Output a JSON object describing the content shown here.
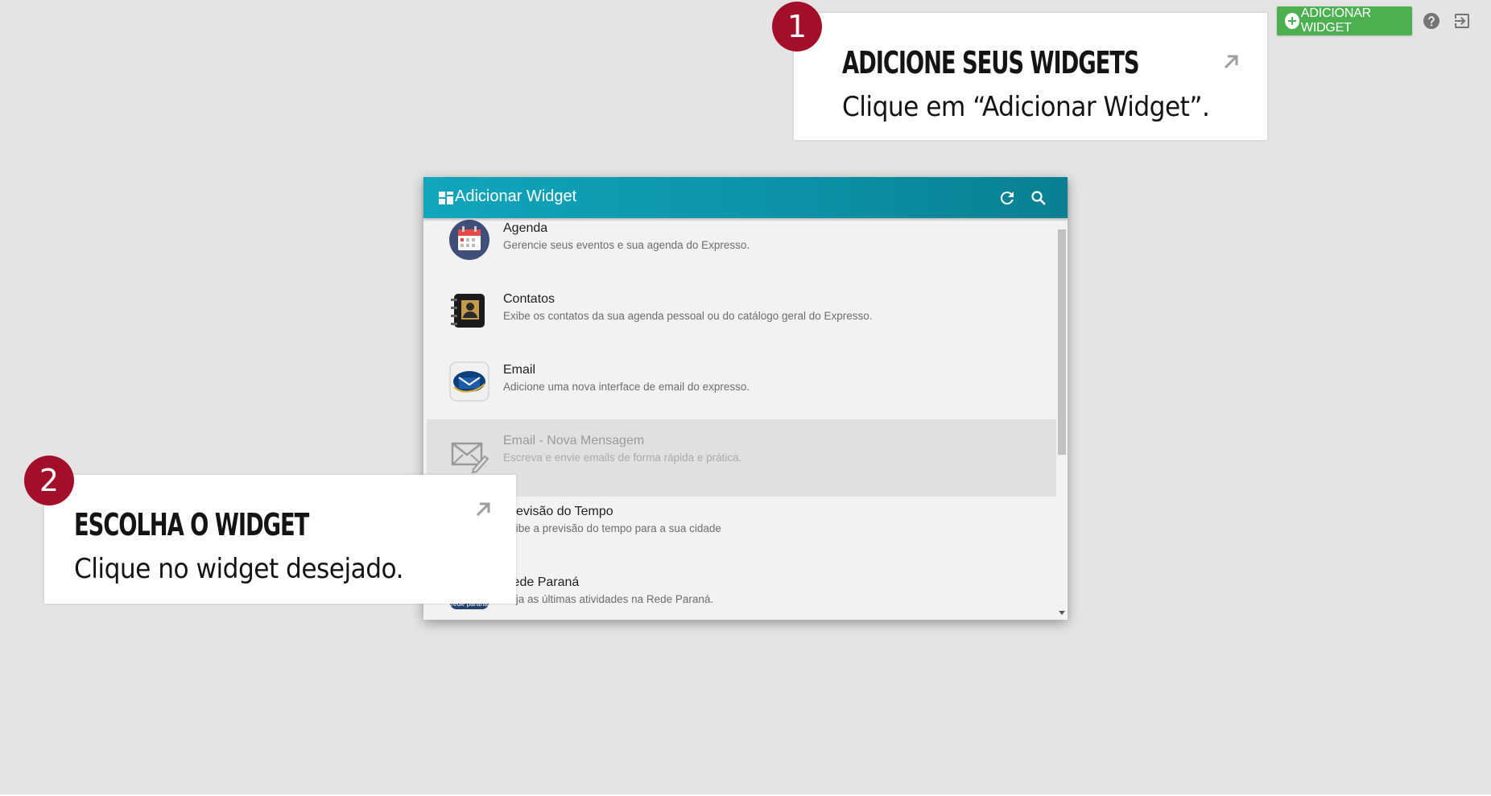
{
  "toolbar": {
    "add_widget_label": "ADICIONAR WIDGET",
    "help_icon": "help-circle-icon",
    "logout_icon": "exit-to-app-icon",
    "accent": "#4caf50"
  },
  "tutorial": {
    "step1": {
      "number": "1",
      "title": "ADICIONE SEUS WIDGETS",
      "text": "Clique em “Adicionar Widget”."
    },
    "step2": {
      "number": "2",
      "title": "ESCOLHA O WIDGET",
      "text": "Clique no widget desejado."
    },
    "badge_color": "#a30f2b"
  },
  "dialog": {
    "title": "Adicionar Widget",
    "header_color": "#0c91a6",
    "icons": [
      "dashboard-icon",
      "refresh-icon",
      "search-icon"
    ],
    "items": [
      {
        "name": "Agenda",
        "description": "Gerencie seus eventos e sua agenda do Expresso.",
        "icon": "calendar-icon"
      },
      {
        "name": "Contatos",
        "description": "Exibe os contatos da sua agenda pessoal ou do catálogo geral do Expresso.",
        "icon": "address-book-icon"
      },
      {
        "name": "Email",
        "description": "Adicione uma nova interface de email do expresso.",
        "icon": "email-envelope-icon"
      },
      {
        "name": "Email - Nova Mensagem",
        "description": "Escreva e envie emails de forma rápida e prática.",
        "icon": "compose-mail-icon"
      },
      {
        "name": "Previsão do Tempo",
        "description": "Exibe a previsão do tempo para a sua cidade",
        "icon": "weather-icon"
      },
      {
        "name": "Rede Paraná",
        "description": "Veja as últimas atividades na Rede Paraná.",
        "icon": "rede-parana-icon",
        "icon_text": "rede paraná"
      }
    ]
  }
}
